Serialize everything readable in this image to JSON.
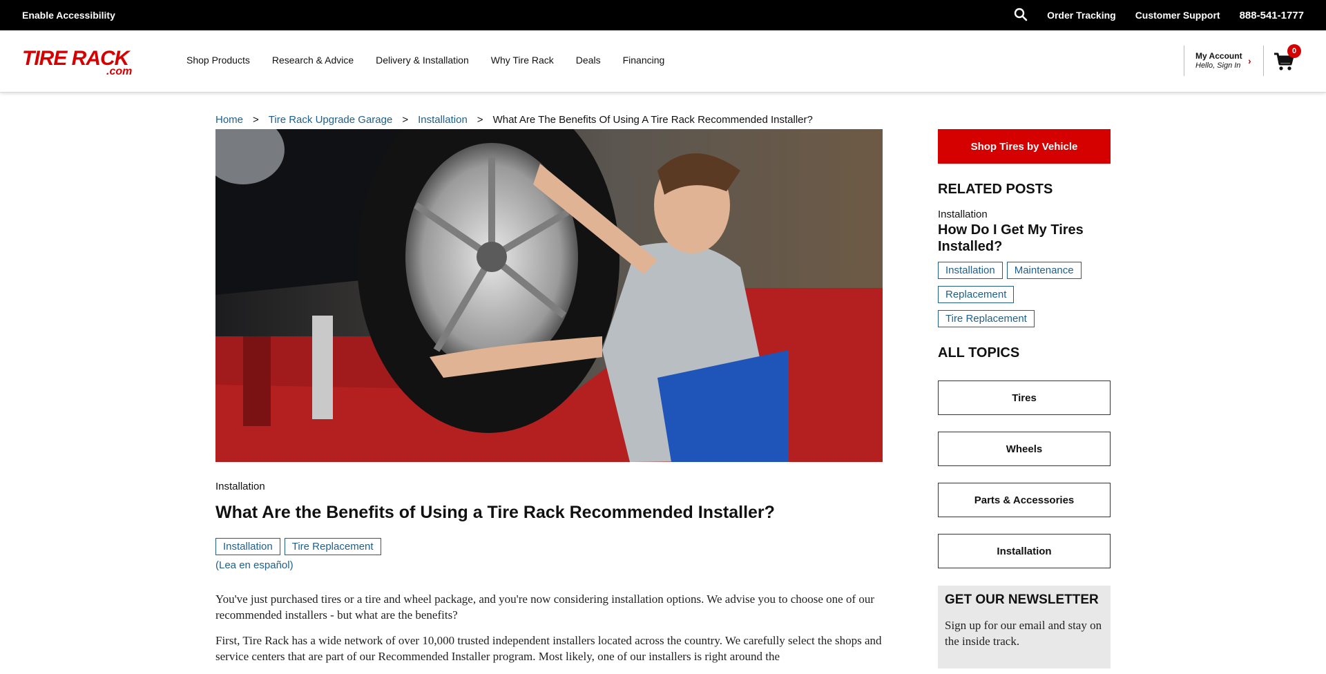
{
  "topbar": {
    "accessibility": "Enable Accessibility",
    "order_tracking": "Order Tracking",
    "customer_support": "Customer Support",
    "phone": "888-541-1777"
  },
  "header": {
    "logo_text": "TIRE RACK",
    "logo_sub": ".com",
    "nav": [
      "Shop Products",
      "Research & Advice",
      "Delivery & Installation",
      "Why Tire Rack",
      "Deals",
      "Financing"
    ],
    "account_title": "My Account",
    "account_sub": "Hello, Sign In",
    "cart_count": "0"
  },
  "breadcrumb": {
    "items": [
      "Home",
      "Tire Rack Upgrade Garage",
      "Installation"
    ],
    "current": "What Are The Benefits Of Using A Tire Rack Recommended Installer?",
    "separator": ">"
  },
  "article": {
    "category": "Installation",
    "title": "What Are the Benefits of Using a Tire Rack Recommended Installer?",
    "tags": [
      "Installation",
      "Tire Replacement"
    ],
    "spanish_link": "(Lea en español)",
    "paragraphs": [
      "You've just purchased tires or a tire and wheel package, and you're now considering installation options. We advise you to choose one of our recommended installers - but what are the benefits?",
      "First, Tire Rack has a wide network of over 10,000 trusted independent installers located across the country. We carefully select the shops and service centers that are part of our Recommended Installer program. Most likely, one of our installers is right around the"
    ]
  },
  "sidebar": {
    "shop_button": "Shop Tires by Vehicle",
    "related_heading": "RELATED POSTS",
    "related": {
      "category": "Installation",
      "title": "How Do I Get My Tires Installed?",
      "tags": [
        "Installation",
        "Maintenance",
        "Replacement",
        "Tire Replacement"
      ]
    },
    "topics_heading": "ALL TOPICS",
    "topics": [
      "Tires",
      "Wheels",
      "Parts & Accessories",
      "Installation"
    ],
    "newsletter_heading": "GET OUR NEWSLETTER",
    "newsletter_text": "Sign up for our email and stay on the inside track."
  },
  "colors": {
    "brand_red": "#d50000",
    "link_blue": "#1d5f8a"
  }
}
